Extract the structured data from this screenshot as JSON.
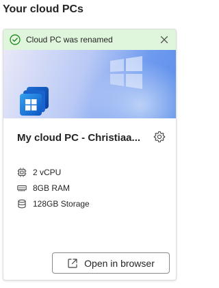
{
  "page": {
    "title": "Your cloud PCs"
  },
  "toast": {
    "message": "Cloud PC was renamed",
    "color": "#dff6dd"
  },
  "card": {
    "name": "My cloud PC - Christiaa...",
    "specs": [
      {
        "icon": "cpu-icon",
        "label": "2 vCPU"
      },
      {
        "icon": "ram-icon",
        "label": "8GB RAM"
      },
      {
        "icon": "storage-icon",
        "label": "128GB Storage"
      }
    ],
    "open_button_label": "Open in browser"
  }
}
